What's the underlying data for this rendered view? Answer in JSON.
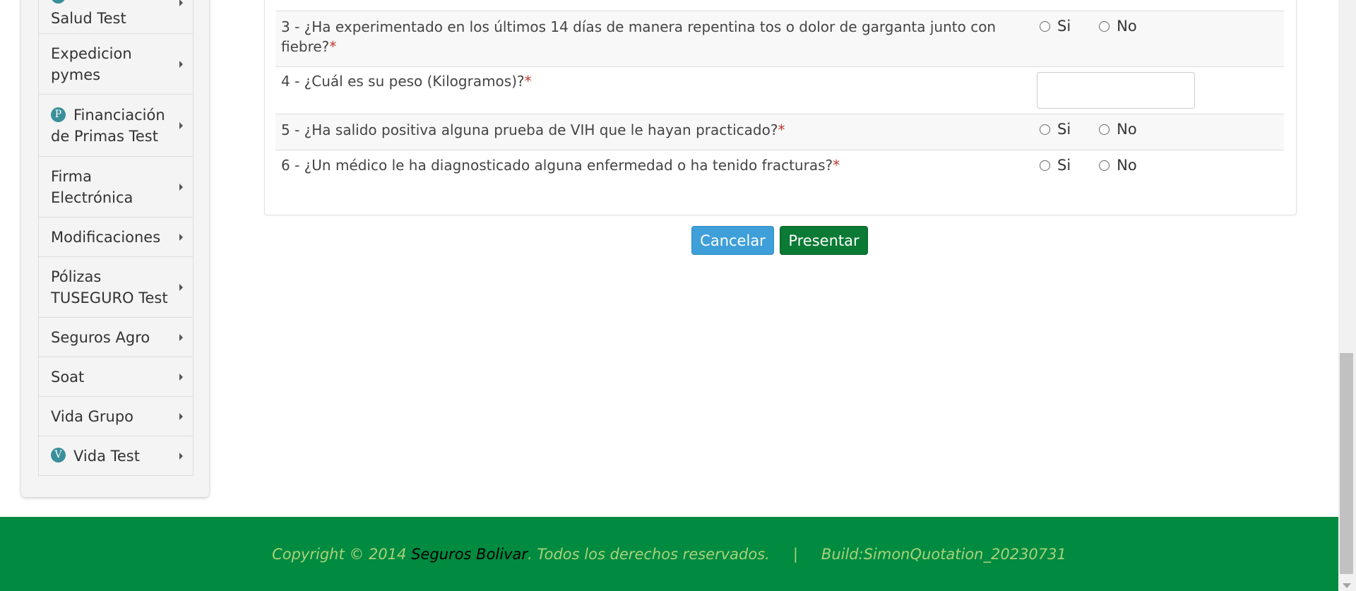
{
  "sidebar": {
    "items": [
      {
        "lines": [
          "Salud Test"
        ],
        "badge": ""
      },
      {
        "lines": [
          "Expedicion",
          "pymes"
        ],
        "badge": ""
      },
      {
        "lines": [
          "Financiación",
          "de Primas Test"
        ],
        "badge": "P"
      },
      {
        "lines": [
          "Firma",
          "Electrónica"
        ],
        "badge": ""
      },
      {
        "lines": [
          "Modificaciones"
        ],
        "badge": ""
      },
      {
        "lines": [
          "Pólizas",
          "TUSEGURO Test"
        ],
        "badge": ""
      },
      {
        "lines": [
          "Seguros Agro"
        ],
        "badge": ""
      },
      {
        "lines": [
          "Soat"
        ],
        "badge": ""
      },
      {
        "lines": [
          "Vida Grupo"
        ],
        "badge": ""
      },
      {
        "lines": [
          "Vida Test"
        ],
        "badge": "V"
      }
    ]
  },
  "form": {
    "required_mark": "*",
    "questions": [
      {
        "text_line1": "3 - ¿Ha experimentado en los últimos 14 días de manera repentina tos o dolor de garganta junto con",
        "text_line2": "fiebre?",
        "type": "radio",
        "options": [
          "Si",
          "No"
        ]
      },
      {
        "text": "4 - ¿Cuál es su peso (Kilogramos)?",
        "type": "text",
        "value": ""
      },
      {
        "text": "5 - ¿Ha salido positiva alguna prueba de VIH que le hayan practicado?",
        "type": "radio",
        "options": [
          "Si",
          "No"
        ]
      },
      {
        "text": "6 - ¿Un médico le ha diagnosticado alguna enfermedad o ha tenido fracturas?",
        "type": "radio",
        "options": [
          "Si",
          "No"
        ]
      }
    ]
  },
  "actions": {
    "cancel_label": "Cancelar",
    "submit_label": "Presentar"
  },
  "footer": {
    "copyright_prefix": "Copyright © 2014 ",
    "brand": "Seguros Bolivar",
    "rights": ". Todos los derechos reservados.",
    "separator": "|",
    "build": "Build:SimonQuotation_20230731"
  },
  "colors": {
    "accent_green": "#008b40",
    "cancel_blue": "#3f9fd8",
    "submit_green": "#0a7a34",
    "required_red": "#c0392b",
    "badge_teal": "#3a8f9b"
  }
}
